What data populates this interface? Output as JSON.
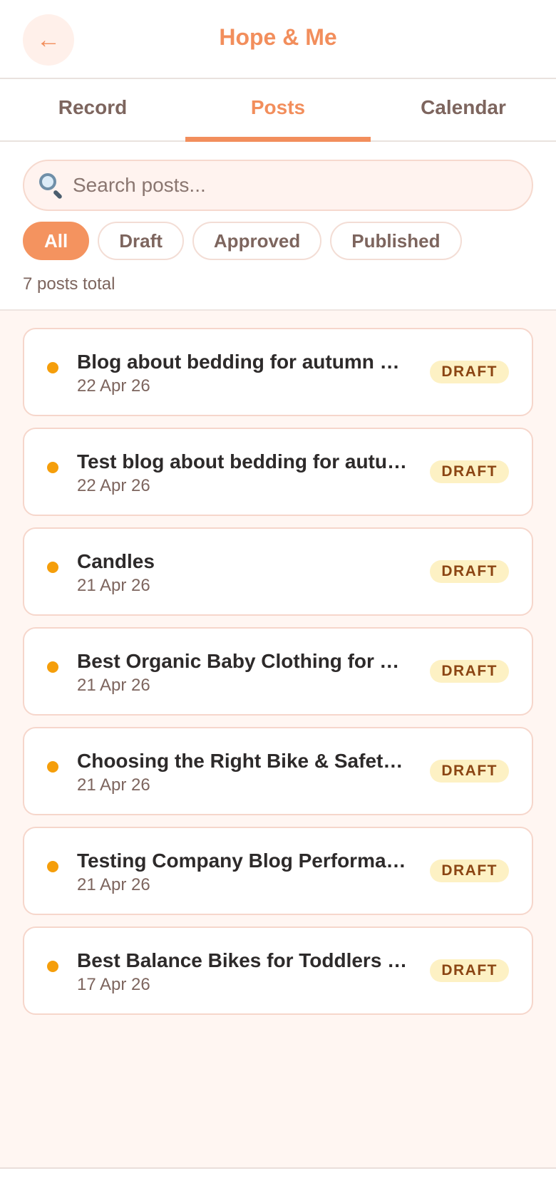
{
  "header": {
    "back_icon": "←",
    "title": "Hope & Me"
  },
  "tabs": [
    {
      "label": "Record",
      "active": false
    },
    {
      "label": "Posts",
      "active": true
    },
    {
      "label": "Calendar",
      "active": false
    }
  ],
  "search": {
    "icon": "search-icon",
    "placeholder": "Search posts...",
    "value": ""
  },
  "filters": [
    {
      "label": "All",
      "active": true
    },
    {
      "label": "Draft",
      "active": false
    },
    {
      "label": "Approved",
      "active": false
    },
    {
      "label": "Published",
      "active": false
    }
  ],
  "total_text": "7 posts total",
  "posts": [
    {
      "title": "Blog about bedding for autumn …",
      "date": "22 Apr 26",
      "status": "DRAFT"
    },
    {
      "title": "Test blog about bedding for autu…",
      "date": "22 Apr 26",
      "status": "DRAFT"
    },
    {
      "title": "Candles",
      "date": "21 Apr 26",
      "status": "DRAFT"
    },
    {
      "title": "Best Organic Baby Clothing for Y…",
      "date": "21 Apr 26",
      "status": "DRAFT"
    },
    {
      "title": "Choosing the Right Bike & Safet…",
      "date": "21 Apr 26",
      "status": "DRAFT"
    },
    {
      "title": "Testing Company Blog Performa…",
      "date": "21 Apr 26",
      "status": "DRAFT"
    },
    {
      "title": "Best Balance Bikes for Toddlers …",
      "date": "17 Apr 26",
      "status": "DRAFT"
    }
  ],
  "colors": {
    "accent": "#f28e5c",
    "draft_dot": "#f59e0b",
    "badge_bg": "#fdf1c4",
    "badge_text": "#8b4513"
  }
}
